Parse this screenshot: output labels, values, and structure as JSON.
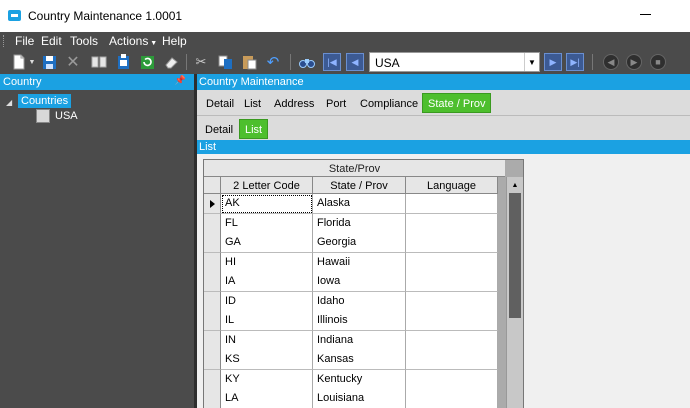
{
  "window": {
    "title": "Country Maintenance 1.0001"
  },
  "menu": {
    "file": "File",
    "edit": "Edit",
    "tools": "Tools",
    "actions": "Actions",
    "help": "Help"
  },
  "toolbar": {
    "key_value": "USA",
    "icons": [
      "new-icon",
      "save-icon",
      "delete-icon",
      "open-book-icon",
      "attach-icon",
      "refresh-icon",
      "eraser-icon",
      "cut-icon",
      "copy-icon",
      "paste-icon",
      "undo-icon",
      "binoculars-icon",
      "first-record-icon",
      "previous-record-icon",
      "next-record-icon",
      "last-record-icon",
      "back-icon",
      "forward-icon",
      "stop-icon"
    ]
  },
  "tree": {
    "header": "Country",
    "root_label": "Countries",
    "child_label": "USA"
  },
  "main": {
    "header": "Country Maintenance",
    "tabs": [
      "Detail",
      "List",
      "Address",
      "Port",
      "Compliance",
      "State / Prov"
    ],
    "active_tab": "State / Prov",
    "subtabs": [
      "Detail",
      "List"
    ],
    "active_subtab": "List",
    "section_label": "List"
  },
  "grid": {
    "caption": "State/Prov",
    "columns": [
      "2 Letter Code",
      "State / Prov",
      "Language"
    ],
    "rows": [
      [
        "AK",
        "Alaska",
        ""
      ],
      [
        "FL",
        "Florida",
        ""
      ],
      [
        "GA",
        "Georgia",
        ""
      ],
      [
        "HI",
        "Hawaii",
        ""
      ],
      [
        "IA",
        "Iowa",
        ""
      ],
      [
        "ID",
        "Idaho",
        ""
      ],
      [
        "IL",
        "Illinois",
        ""
      ],
      [
        "IN",
        "Indiana",
        ""
      ],
      [
        "KS",
        "Kansas",
        ""
      ],
      [
        "KY",
        "Kentucky",
        ""
      ],
      [
        "LA",
        "Louisiana",
        ""
      ]
    ]
  },
  "colors": {
    "accent": "#1ba1e2",
    "active_tab": "#4dbf2d",
    "chrome": "#4b4b4b"
  }
}
